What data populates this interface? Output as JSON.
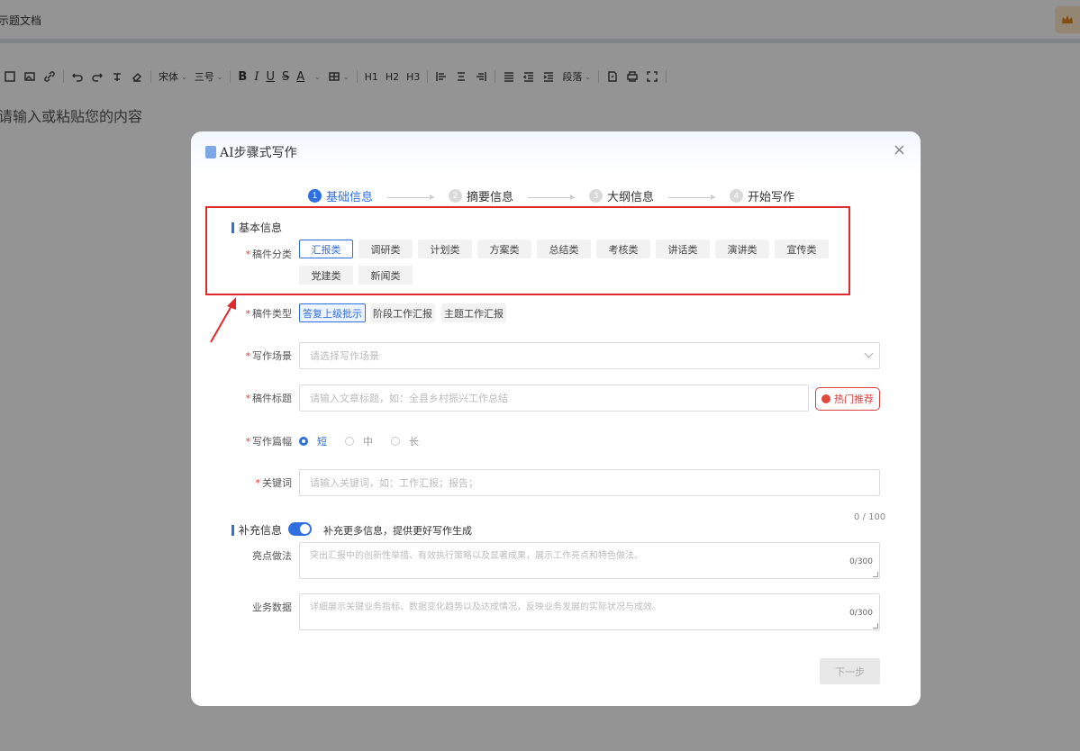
{
  "editor": {
    "doc_title": "示题文档",
    "placeholder": "请输入或粘贴您的内容",
    "toolbar": {
      "font_family": "宋体",
      "font_size": "三号",
      "h1": "H1",
      "h2": "H2",
      "h3": "H3",
      "paragraph": "段落"
    }
  },
  "modal": {
    "title": "AI步骤式写作",
    "close_label": "×",
    "steps": [
      {
        "num": "1",
        "label": "基础信息"
      },
      {
        "num": "2",
        "label": "摘要信息"
      },
      {
        "num": "3",
        "label": "大纲信息"
      },
      {
        "num": "4",
        "label": "开始写作"
      }
    ],
    "basic_section_title": "基本信息",
    "category_label": "稿件分类",
    "categories": [
      "汇报类",
      "调研类",
      "计划类",
      "方案类",
      "总结类",
      "考核类",
      "讲话类",
      "演讲类",
      "宣传类",
      "党建类",
      "新闻类"
    ],
    "selected_category": "汇报类",
    "type_label": "稿件类型",
    "types": [
      "答复上级批示",
      "阶段工作汇报",
      "主题工作汇报"
    ],
    "scene_label": "写作场景",
    "scene_placeholder": "请选择写作场景",
    "title_label": "稿件标题",
    "title_placeholder": "请输入文章标题，如：全县乡村振兴工作总结",
    "hot_button": "热门推荐",
    "length_label": "写作篇幅",
    "lengths": [
      "短",
      "中",
      "长"
    ],
    "selected_length": "短",
    "keywords_label": "关键词",
    "keywords_placeholder": "请输入关键词，如：工作汇报；报告；",
    "keywords_counter": "0 / 100",
    "extra_section_title": "补充信息",
    "extra_toggle_desc": "补充更多信息，提供更好写作生成",
    "extra_toggle_on": true,
    "highlights_label": "亮点做法",
    "highlights_placeholder": "突出汇报中的创新性举措、有效执行策略以及显著成果，展示工作亮点和特色做法。",
    "highlights_counter": "0/300",
    "business_label": "业务数据",
    "business_placeholder": "详细展示关键业务指标、数据变化趋势以及达成情况，反映业务发展的实际状况与成效。",
    "business_counter": "0/300",
    "next_button": "下一步"
  },
  "colors": {
    "accent": "#2f6fe0",
    "annotation": "#e0292c",
    "hot": "#d84040"
  }
}
